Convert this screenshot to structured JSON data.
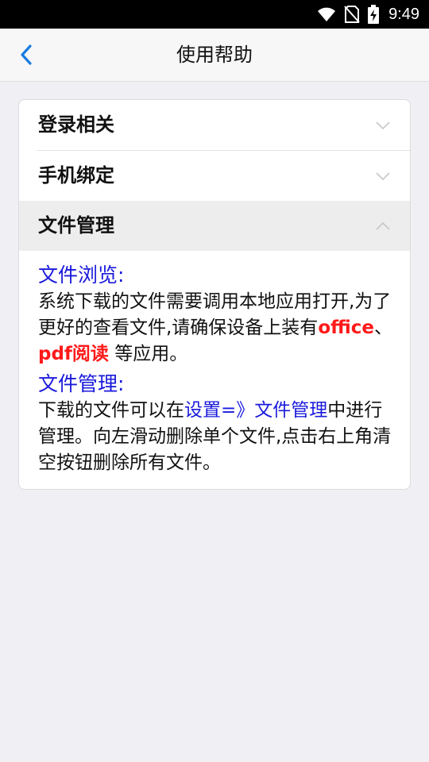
{
  "status_bar": {
    "time": "9:49",
    "icons": [
      "wifi-icon",
      "no-sim-icon",
      "battery-charging-icon"
    ]
  },
  "navbar": {
    "back_icon": "chevron-left-icon",
    "title": "使用帮助"
  },
  "help_sections": [
    {
      "label": "登录相关",
      "expanded": false,
      "icon": "chevron-down-icon"
    },
    {
      "label": "手机绑定",
      "expanded": false,
      "icon": "chevron-down-icon"
    },
    {
      "label": "文件管理",
      "expanded": true,
      "icon": "chevron-up-icon"
    }
  ],
  "file_management": {
    "browse_title": "文件浏览:",
    "browse_text_1": "系统下载的文件需要调用本地应用打开,为了更好的查看文件,请确保设备上装有",
    "browse_office": "office",
    "browse_sep": "、",
    "browse_pdf": "pdf阅读",
    "browse_text_2": " 等应用。",
    "manage_title": "文件管理:",
    "manage_text_1": "下载的文件可以在",
    "manage_link_settings": "设置=》",
    "manage_link_files": "文件管理",
    "manage_text_2": "中进行管理。向左滑动删除单个文件,点击右上角清空按钮删除所有文件。"
  },
  "colors": {
    "accent": "#1a7be0",
    "link_blue": "#1a1adc",
    "highlight_red": "#ff1a1a",
    "background": "#efeff4"
  }
}
